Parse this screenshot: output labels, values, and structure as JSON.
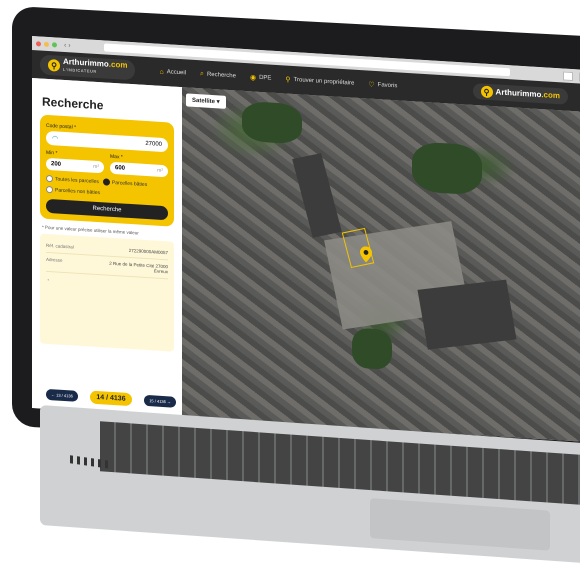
{
  "browser": {
    "nav_arrows": "‹ ›"
  },
  "header": {
    "brand_left": "Arthurimmo",
    "brand_left_hl": ".com",
    "brand_sub": "L'INDICATEUR",
    "menu": [
      {
        "icon": "⌂",
        "label": "Accueil"
      },
      {
        "icon": "⌕",
        "label": "Recherche"
      },
      {
        "icon": "◉",
        "label": "DPE"
      },
      {
        "icon": "⚲",
        "label": "Trouver un propriétaire"
      },
      {
        "icon": "♡",
        "label": "Favoris"
      }
    ],
    "brand_right": "Arthurimmo",
    "brand_right_hl": ".com"
  },
  "sidebar": {
    "title": "Recherche",
    "postal_label": "Code postal *",
    "postal_value": "27000",
    "min_label": "Min *",
    "max_label": "Max *",
    "min_value": "200",
    "max_value": "600",
    "unit": "m²",
    "radio_all": "Toutes les parcelles",
    "radio_built": "Parcelles bâties",
    "radio_unbuilt": "Parcelles non bâties",
    "search_button": "Recherche",
    "note": "* Pour une valeur précise utiliser la même valeur",
    "result": {
      "cadastre_label": "Réf. cadastral",
      "cadastre_value": "272290000AM0057",
      "address_label": "Adresse",
      "address_value_1": "2 Rue de la Petite Cité 27000",
      "address_value_2": "Évreux"
    },
    "pager": {
      "prev": "← 13 / 4136",
      "current": "14 / 4136",
      "next": "15 / 4136 →"
    }
  },
  "map": {
    "type_button": "Satellite ▾"
  },
  "colors": {
    "accent": "#f4c400",
    "header_bg": "#2a2a2a",
    "pager_btn": "#1a2b4a"
  }
}
